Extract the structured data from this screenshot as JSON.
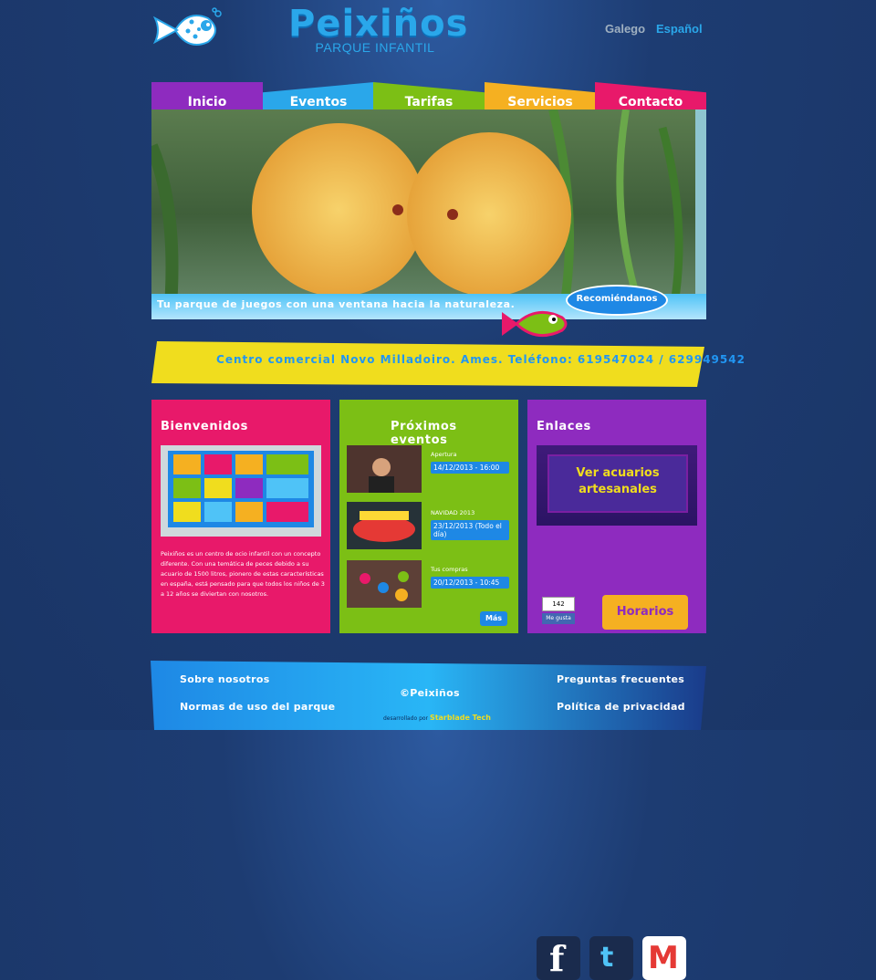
{
  "header": {
    "brand_name": "Peixiños",
    "brand_sub": "PARQUE INFANTIL",
    "lang_gl": "Galego",
    "lang_es": "Español"
  },
  "nav": {
    "tabs": [
      {
        "label": "Inicio",
        "color": "#8e2bbf"
      },
      {
        "label": "Eventos",
        "color": "#2aa7ea"
      },
      {
        "label": "Tarifas",
        "color": "#7cbf15"
      },
      {
        "label": "Servicios",
        "color": "#f5b021"
      },
      {
        "label": "Contacto",
        "color": "#e8196a"
      }
    ]
  },
  "hero": {
    "caption": "Tu parque de juegos con una ventana hacia la naturaleza.",
    "recommend": "Recomiéndanos"
  },
  "banner": {
    "text": "Centro comercial Novo Milladoiro. Ames. Teléfono: 619547024 / 629949542",
    "color": "#f0dd1e"
  },
  "welcome": {
    "title": "Bienvenidos",
    "body": "Peixiños es un centro de ocio infantil con un concepto diferente. Con una temática de peces debido a su acuario de 1500 litros, pionero de estas características en españa, está pensado para que todos los niños de 3 a 12 años se diviertan con nosotros."
  },
  "events": {
    "title": "Próximos eventos",
    "items": [
      {
        "title": "Apertura",
        "date": "14/12/2013 - 16:00"
      },
      {
        "title": "NAVIDAD 2013",
        "date": "23/12/2013 (Todo el día)"
      },
      {
        "title": "Tus compras",
        "date": "20/12/2013 - 10:45"
      }
    ],
    "more": "Más"
  },
  "links": {
    "title": "Enlaces",
    "aquarium": "Ver acuarios artesanales",
    "like_count": "142",
    "like_label": "Me gusta",
    "horarios": "Horarios"
  },
  "footer": {
    "about": "Sobre nosotros",
    "rules": "Normas de uso del parque",
    "copyright": "©Peixiños",
    "faq": "Preguntas frecuentes",
    "privacy": "Política de privacidad",
    "dev_prefix": "desarrollado por",
    "dev_name": "Starblade Tech"
  }
}
